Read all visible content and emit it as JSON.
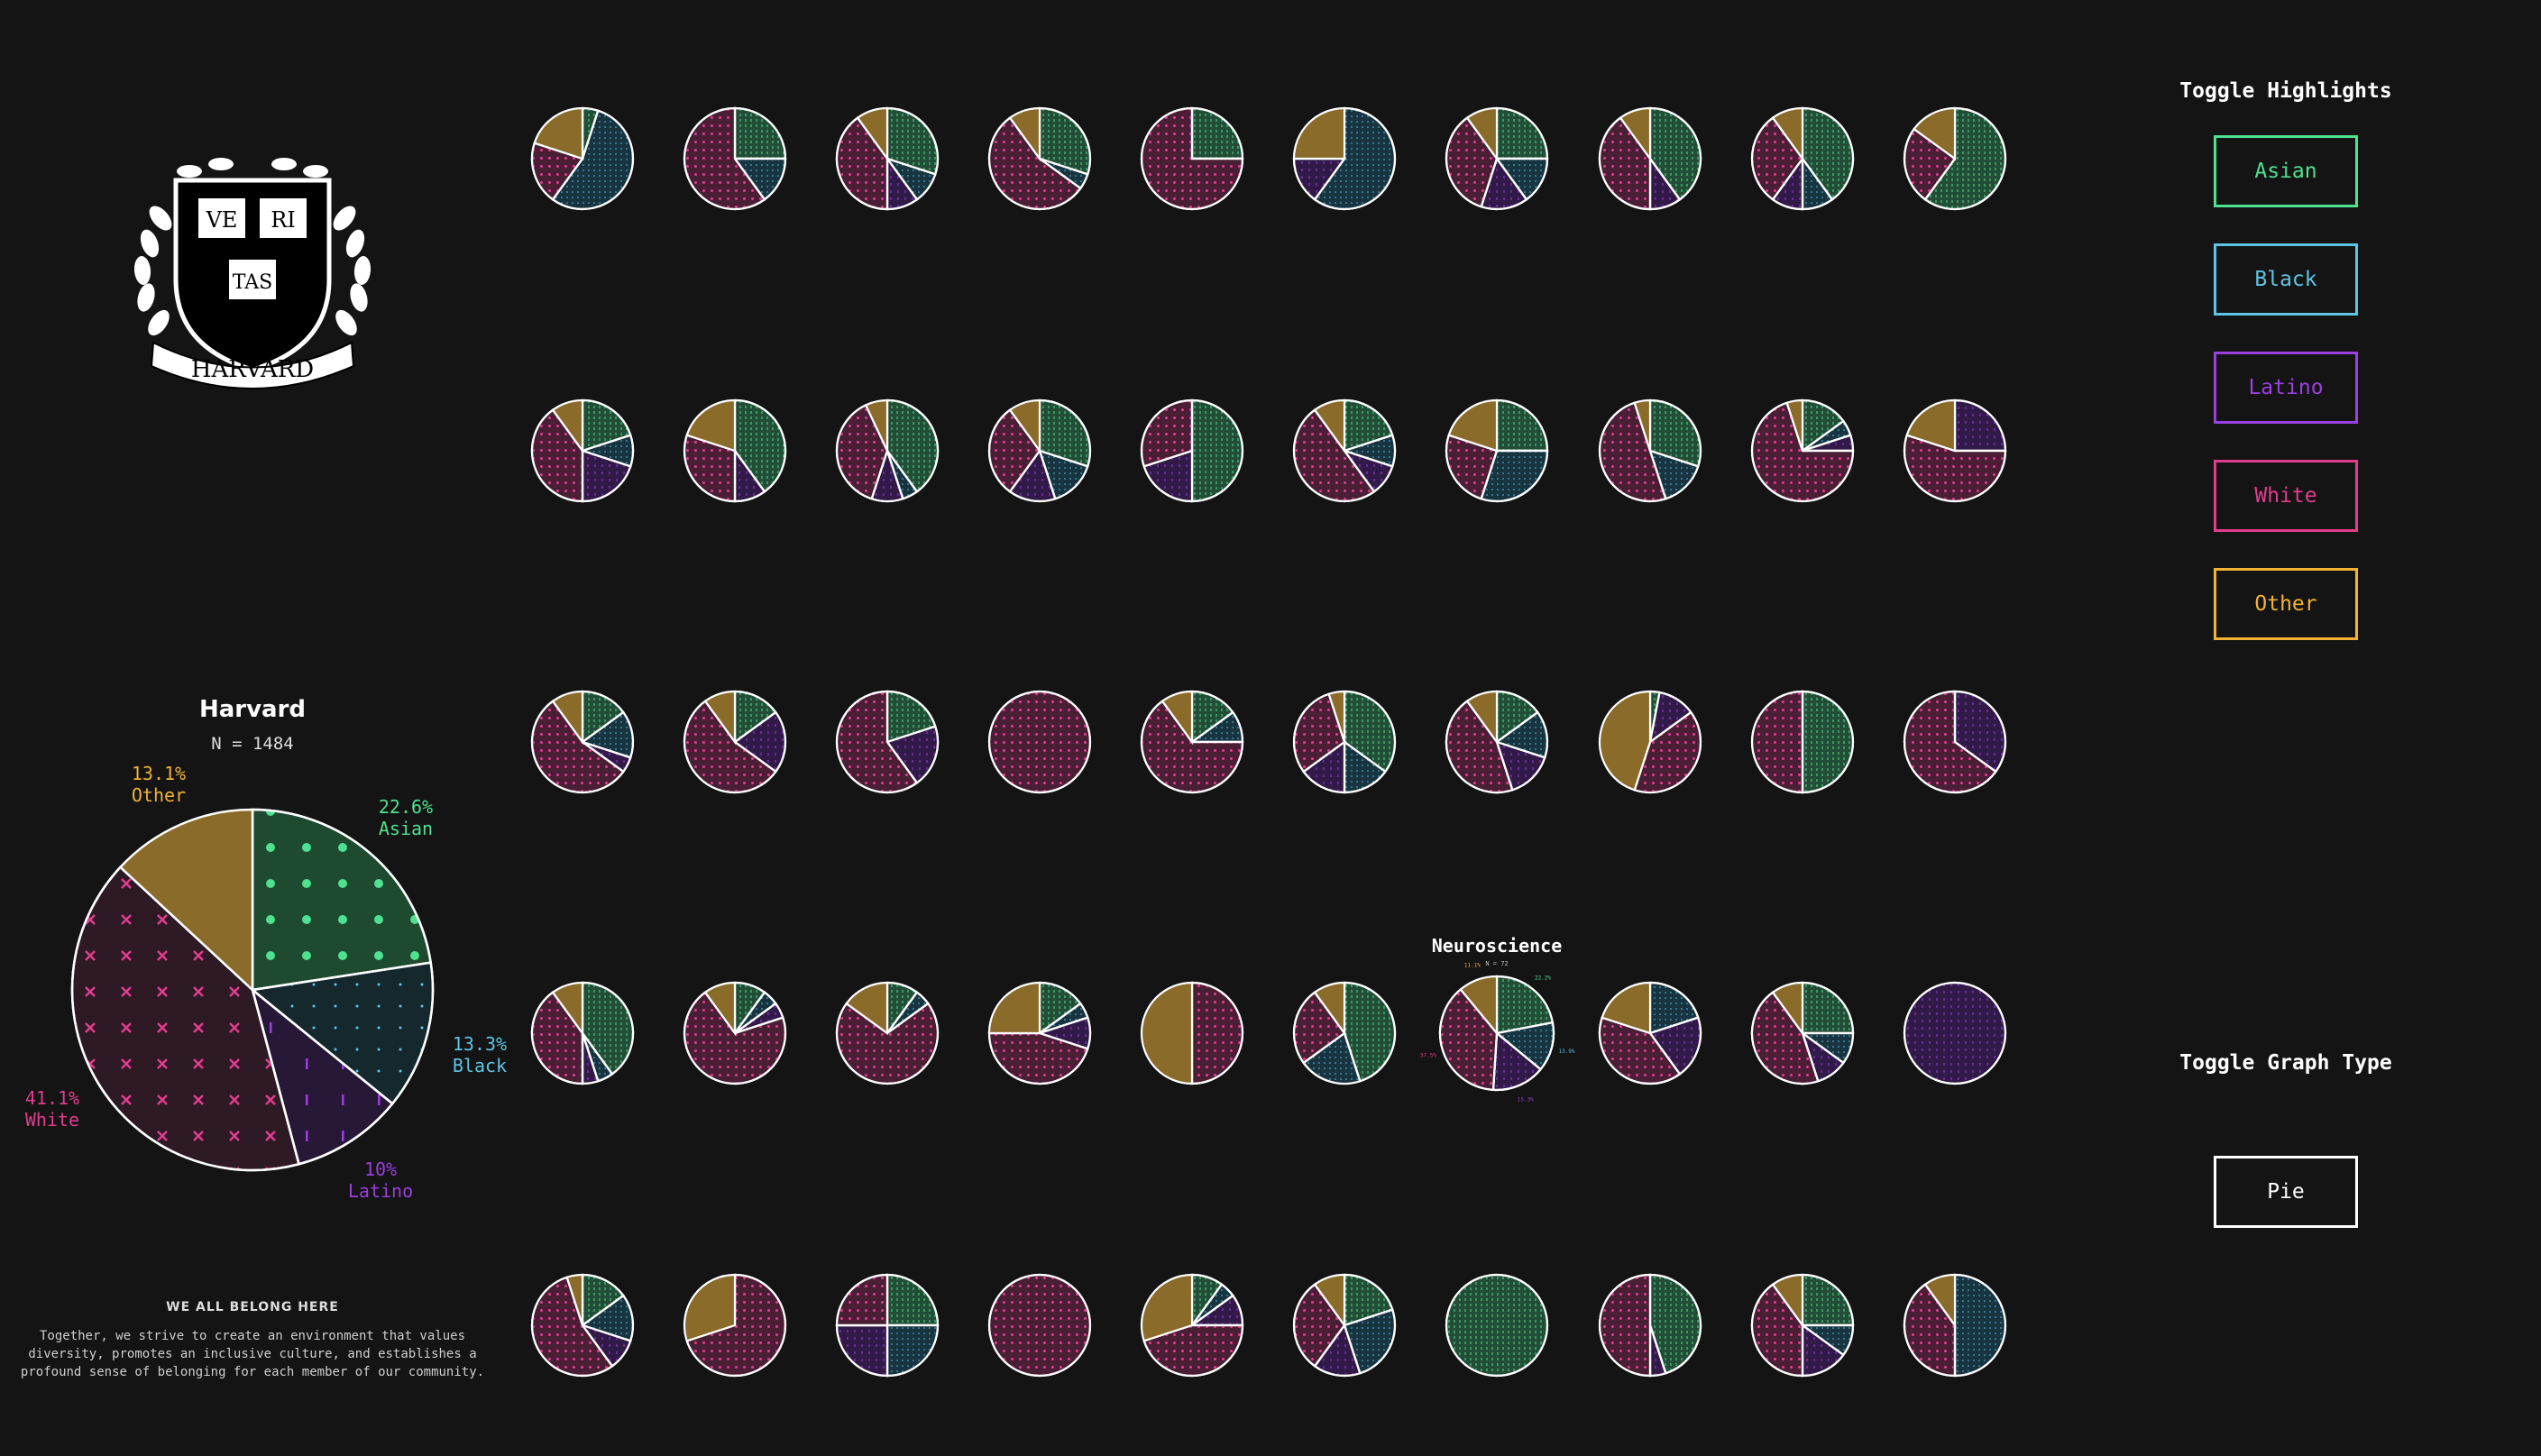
{
  "colors": {
    "Asian": "#4ee18f",
    "Black": "#5ec4e6",
    "Latino": "#9b3fe0",
    "White": "#e23c8e",
    "Other": "#f2b233",
    "background": "#141414"
  },
  "logo": {
    "line1_left": "VE",
    "line1_right": "RI",
    "line2": "TAS",
    "banner": "HARVARD"
  },
  "summary": {
    "title": "Harvard",
    "n_label": "N = 1484",
    "slice_labels": {
      "Asian": {
        "pct": "22.6%",
        "name": "Asian"
      },
      "Black": {
        "pct": "13.3%",
        "name": "Black"
      },
      "Latino": {
        "pct": "10%",
        "name": "Latino"
      },
      "White": {
        "pct": "41.1%",
        "name": "White"
      },
      "Other": {
        "pct": "13.1%",
        "name": "Other"
      }
    }
  },
  "footer": {
    "title": "WE ALL BELONG HERE",
    "lines": [
      "Together, we strive to create an environment that values",
      "diversity, promotes an inclusive culture, and establishes a",
      "profound sense of belonging for each member of our community."
    ]
  },
  "highlight_panel": {
    "title": "Toggle Highlights",
    "buttons": [
      "Asian",
      "Black",
      "Latino",
      "White",
      "Other"
    ]
  },
  "graph_type_panel": {
    "title": "Toggle Graph Type",
    "button": "Pie"
  },
  "chart_data": [
    {
      "type": "pie",
      "title": "Harvard",
      "subtitle": "N = 1484",
      "categories": [
        "Asian",
        "Black",
        "Latino",
        "White",
        "Other"
      ],
      "values": [
        22.6,
        13.3,
        10.0,
        41.1,
        13.1
      ]
    },
    {
      "type": "pie",
      "categories": [
        "Asian",
        "Black",
        "Latino",
        "White",
        "Other"
      ],
      "rows": [
        [
          [
            5,
            55,
            0,
            20,
            20
          ],
          [
            25,
            15,
            0,
            60,
            0
          ],
          [
            30,
            10,
            10,
            40,
            10
          ],
          [
            30,
            5,
            0,
            55,
            10
          ],
          [
            25,
            0,
            0,
            75,
            0
          ],
          [
            0,
            60,
            15,
            0,
            25
          ],
          [
            25,
            15,
            15,
            35,
            10
          ],
          [
            40,
            0,
            10,
            40,
            10
          ],
          [
            40,
            10,
            10,
            30,
            10
          ],
          [
            60,
            0,
            0,
            25,
            15
          ]
        ],
        [
          [
            20,
            10,
            20,
            40,
            10
          ],
          [
            40,
            0,
            10,
            30,
            20
          ],
          [
            40,
            5,
            10,
            38,
            7
          ],
          [
            30,
            15,
            15,
            30,
            10
          ],
          [
            50,
            0,
            20,
            30,
            0
          ],
          [
            20,
            10,
            10,
            50,
            10
          ],
          [
            25,
            30,
            0,
            25,
            20
          ],
          [
            30,
            15,
            0,
            50,
            5
          ],
          [
            15,
            5,
            5,
            70,
            5
          ],
          [
            0,
            0,
            25,
            55,
            20
          ]
        ],
        [
          [
            15,
            15,
            5,
            55,
            10
          ],
          [
            15,
            0,
            20,
            55,
            10
          ],
          [
            20,
            0,
            20,
            60,
            0
          ],
          [
            0,
            0,
            0,
            100,
            0
          ],
          [
            15,
            10,
            0,
            65,
            10
          ],
          [
            35,
            15,
            15,
            30,
            5
          ],
          [
            15,
            15,
            15,
            45,
            10
          ],
          [
            3,
            0,
            12,
            40,
            45
          ],
          [
            50,
            0,
            0,
            50,
            0
          ],
          [
            0,
            0,
            35,
            65,
            0
          ]
        ],
        [
          [
            40,
            5,
            5,
            40,
            10
          ],
          [
            10,
            5,
            5,
            70,
            10
          ],
          [
            10,
            5,
            0,
            70,
            15
          ],
          [
            15,
            5,
            10,
            45,
            25
          ],
          [
            0,
            0,
            0,
            50,
            50
          ],
          [
            45,
            20,
            0,
            25,
            10
          ],
          [
            22,
            14,
            15,
            38,
            11
          ],
          [
            0,
            20,
            20,
            40,
            20
          ],
          [
            25,
            10,
            10,
            45,
            10
          ],
          [
            0,
            0,
            100,
            0,
            0
          ]
        ],
        [
          [
            15,
            15,
            10,
            55,
            5
          ],
          [
            0,
            0,
            0,
            70,
            30
          ],
          [
            25,
            25,
            25,
            25,
            0
          ],
          [
            0,
            0,
            0,
            100,
            0
          ],
          [
            10,
            5,
            10,
            45,
            30
          ],
          [
            20,
            25,
            15,
            30,
            10
          ],
          [
            100,
            0,
            0,
            0,
            0
          ],
          [
            45,
            0,
            5,
            50,
            0
          ],
          [
            25,
            10,
            15,
            40,
            10
          ],
          [
            0,
            50,
            0,
            40,
            10
          ]
        ]
      ],
      "featured": {
        "row": 3,
        "col": 6,
        "title": "Neuroscience",
        "subtitle": "N = 72",
        "labels": {
          "Asian": "22.2%",
          "Black": "13.9%",
          "Latino": "15.3%",
          "White": "37.5%",
          "Other": "11.1%"
        }
      }
    }
  ]
}
